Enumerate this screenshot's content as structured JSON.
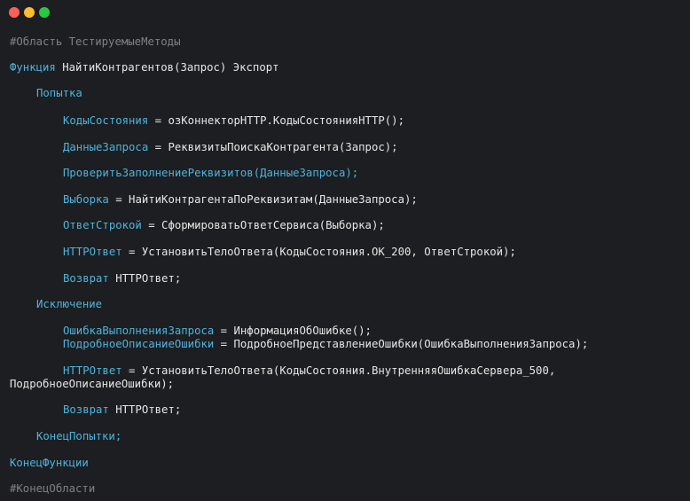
{
  "window": {
    "controls": {
      "close_color": "#ff5f57",
      "minimize_color": "#febc2e",
      "maximize_color": "#28c840"
    }
  },
  "code": {
    "region_start": "#Область ТестируемыеМетоды",
    "func_kw": "Функция",
    "func_sig": " НайтиКонтрагентов(Запрос) Экспорт",
    "try_kw": "Попытка",
    "l1_var": "КодыСостояния",
    "l1_rest": " = озКоннекторHTTP.КодыСостоянияHTTP();",
    "l2_var": "ДанныеЗапроса",
    "l2_rest": " = РеквизитыПоискаКонтрагента(Запрос);",
    "l3_call": "ПроверитьЗаполнениеРеквизитов(ДанныеЗапроса);",
    "l4_var": "Выборка",
    "l4_rest": " = НайтиКонтрагентаПоРеквизитам(ДанныеЗапроса);",
    "l5_var": "ОтветСтрокой",
    "l5_rest": " = СформироватьОтветСервиса(Выборка);",
    "l6_var": "HTTPОтвет",
    "l6_rest": " = УстановитьТелоОтвета(КодыСостояния.OK_200, ОтветСтрокой);",
    "l7_kw": "Возврат",
    "l7_rest": " HTTPОтвет;",
    "except_kw": "Исключение",
    "e1_var": "ОшибкаВыполненияЗапроса",
    "e1_rest": " = ИнформацияОбОшибке();",
    "e2_var": "ПодробноеОписаниеОшибки",
    "e2_rest": " = ПодробноеПредставлениеОшибки(ОшибкаВыполненияЗапроса);",
    "e3_var": "HTTPОтвет",
    "e3_rest": " = УстановитьТелоОтвета(КодыСостояния.ВнутренняяОшибкаСервера_500,",
    "e3_cont": "ПодробноеОписаниеОшибки);",
    "e4_kw": "Возврат",
    "e4_rest": " HTTPОтвет;",
    "endtry_kw": "КонецПопытки;",
    "endfunc_kw": "КонецФункции",
    "region_end": "#КонецОбласти"
  }
}
